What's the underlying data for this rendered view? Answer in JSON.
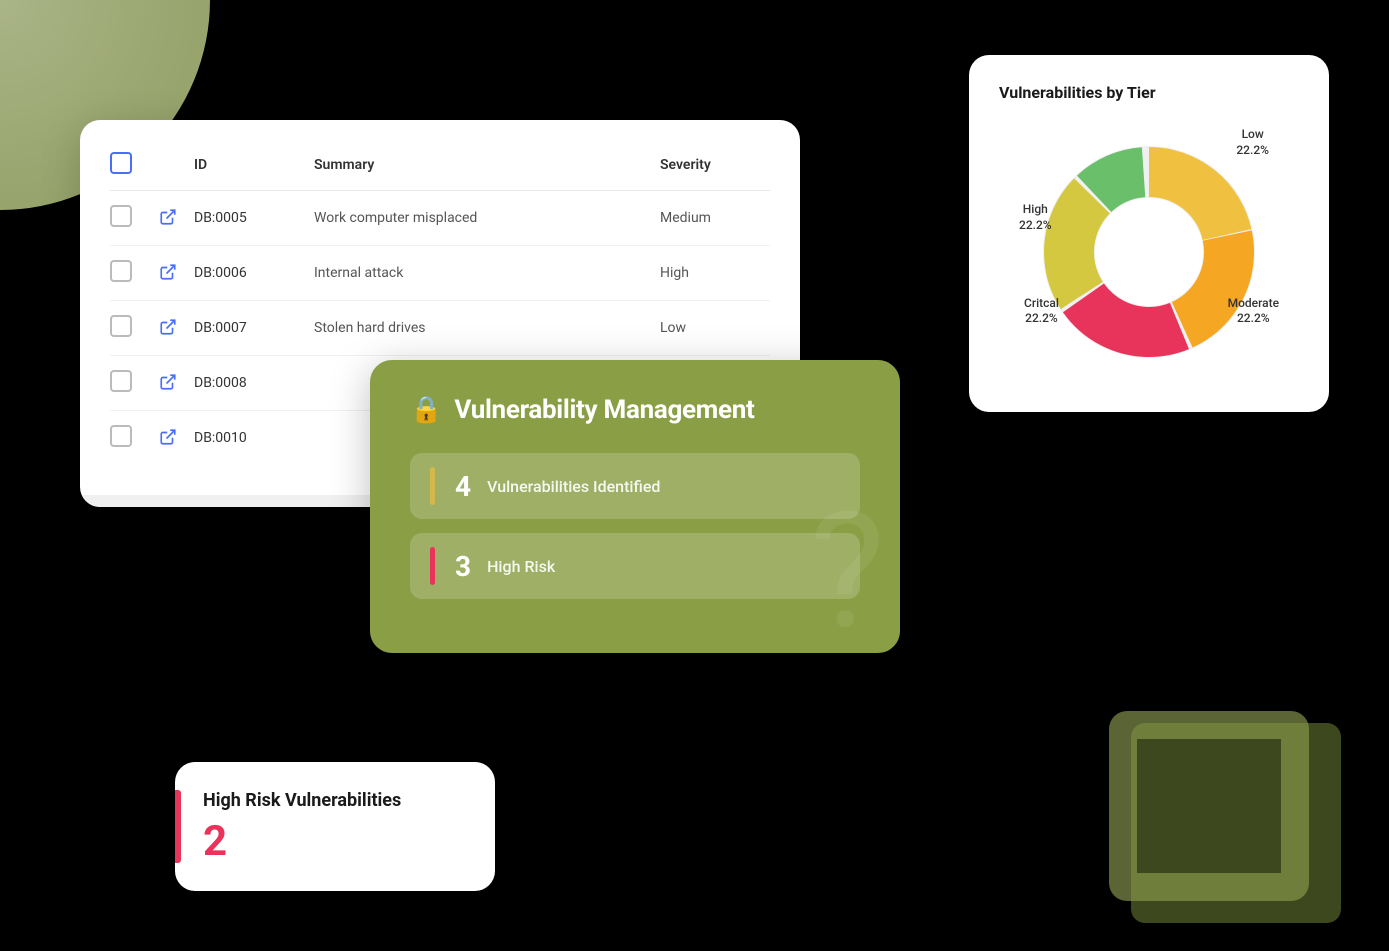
{
  "background": {
    "color": "#000000"
  },
  "table_card": {
    "columns": {
      "id": "ID",
      "summary": "Summary",
      "severity": "Severity"
    },
    "rows": [
      {
        "id": "DB:0005",
        "summary": "Work computer misplaced",
        "severity": "Medium"
      },
      {
        "id": "DB:0006",
        "summary": "Internal attack",
        "severity": "High"
      },
      {
        "id": "DB:0007",
        "summary": "Stolen hard drives",
        "severity": "Low"
      },
      {
        "id": "DB:0008",
        "summary": "",
        "severity": ""
      },
      {
        "id": "DB:0010",
        "summary": "",
        "severity": ""
      }
    ]
  },
  "vuln_mgmt_card": {
    "title": "Vulnerability Management",
    "icon": "🔒",
    "stats": [
      {
        "number": "4",
        "label": "Vulnerabilities Identified",
        "accent": "yellow"
      },
      {
        "number": "3",
        "label": "High Risk",
        "accent": "pink"
      }
    ]
  },
  "high_risk_card": {
    "title": "High Risk Vulnerabilities",
    "value": "2",
    "accent_color": "#e8345a"
  },
  "donut_chart": {
    "title": "Vulnerabilities by Tier",
    "segments": [
      {
        "label": "Low",
        "percentage": "22.2%",
        "color": "#f0c040"
      },
      {
        "label": "High",
        "percentage": "22.2%",
        "color": "#f5a623"
      },
      {
        "label": "Critical",
        "percentage": "22.2%",
        "color": "#e8345a"
      },
      {
        "label": "Moderate",
        "percentage": "22.2%",
        "color": "#f0e060"
      }
    ]
  }
}
